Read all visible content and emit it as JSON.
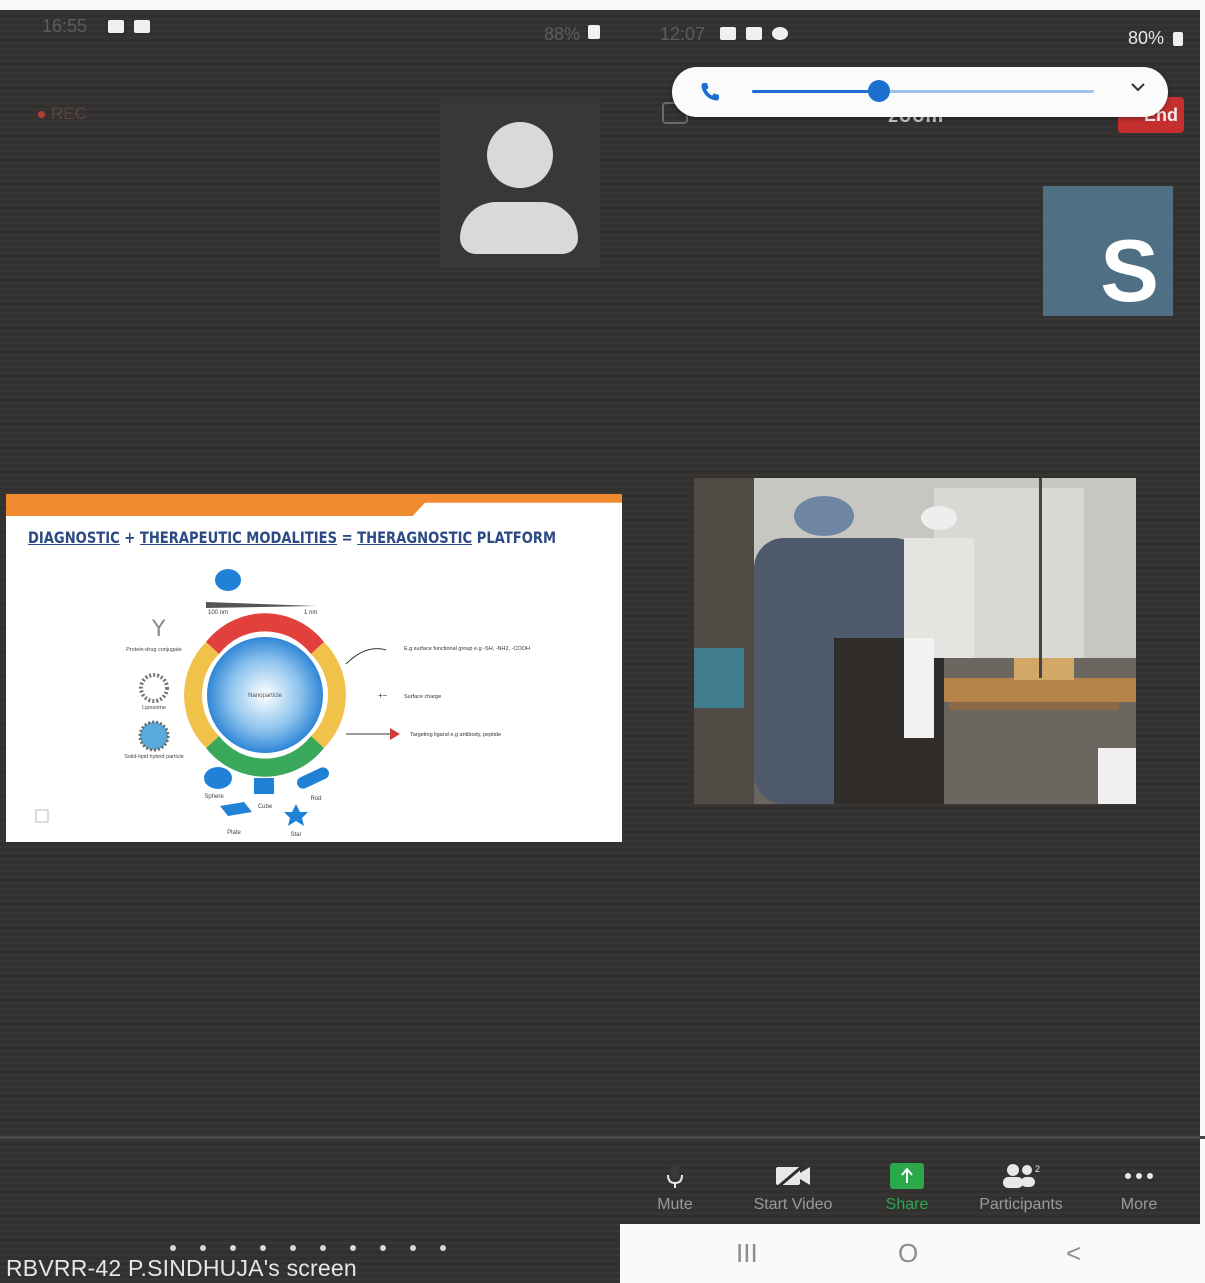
{
  "status_bar_left": {
    "time": "16:55",
    "battery": "88%"
  },
  "status_bar_right": {
    "time": "12:07",
    "battery": "80%"
  },
  "meeting": {
    "recording_label": "REC",
    "app_label": "zoom",
    "end_button_label": "End"
  },
  "volume": {
    "level": 0.37
  },
  "participants": {
    "s_tile_initial": "S"
  },
  "shared_slide": {
    "title_parts": [
      "DIAGNOSTIC",
      "+",
      "THERAPEUTIC MODALITIES",
      "=",
      "THERAGNOSTIC",
      "PLATFORM"
    ],
    "diagram_labels": {
      "size_left": "100 nm",
      "size_right": "1 nm",
      "center": "Nanoparticle",
      "left_items": [
        "Protein-drug conjugate",
        "Liposome",
        "Solid-lipid hybrid particle"
      ],
      "right_items": [
        "E.g surface functional group e.g -SH, -NH2, -COOH",
        "Surface charge",
        "Targeting ligand e.g antibody, peptide"
      ],
      "shapes": [
        "Sphere",
        "Cube",
        "Rod",
        "Plate",
        "Star"
      ]
    }
  },
  "toolbar": {
    "items": [
      {
        "label": "Mute",
        "icon": "mic-icon"
      },
      {
        "label": "Start Video",
        "icon": "video-off-icon"
      },
      {
        "label": "Share",
        "icon": "share-icon",
        "color": "#2aa84a"
      },
      {
        "label": "Participants",
        "icon": "participants-icon",
        "count": "2"
      },
      {
        "label": "More",
        "icon": "more-icon"
      }
    ]
  },
  "nav": {
    "recent": "III",
    "home": "O",
    "back": "<"
  },
  "screen_caption": "RBVRR-42  P.SINDHUJA's screen"
}
